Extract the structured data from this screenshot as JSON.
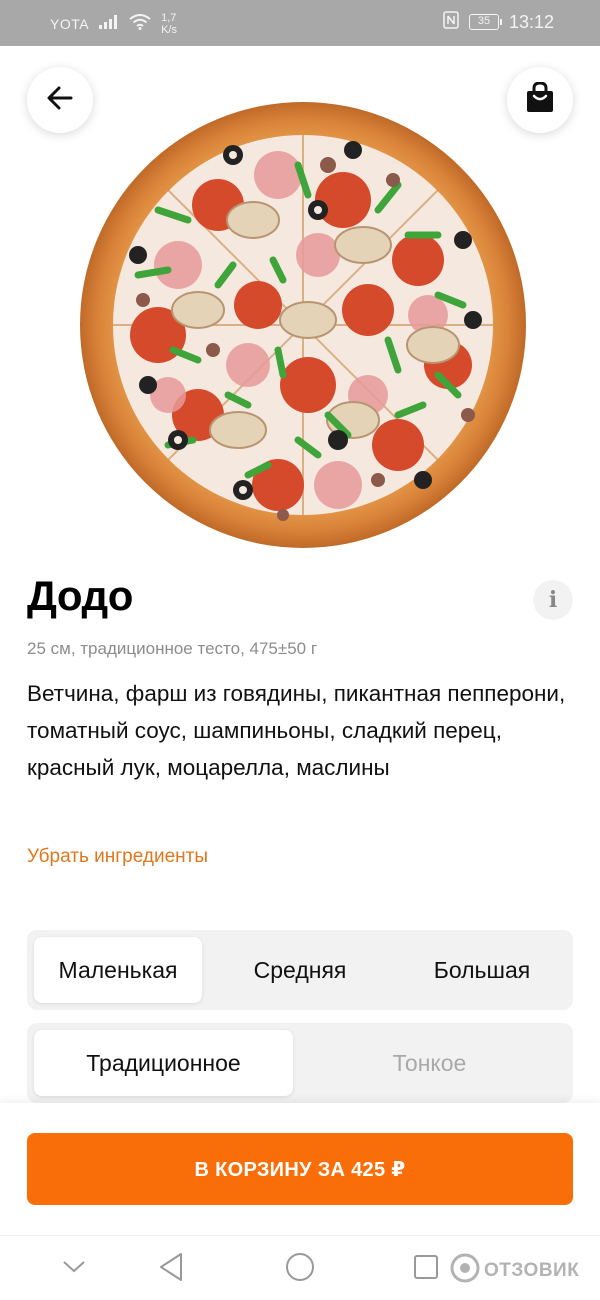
{
  "status_bar": {
    "carrier": "YOTA",
    "speed_value": "1,7",
    "speed_unit": "K/s",
    "battery": "35",
    "time": "13:12"
  },
  "top_bar": {
    "back_icon": "arrow-left-icon",
    "cart_icon": "shopping-bag-icon"
  },
  "product": {
    "image": "pizza-photo",
    "title": "Додо",
    "subtitle": "25 см, традиционное тесто, 475±50 г",
    "description": "Ветчина, фарш из говядины, пикантная пепперони, томатный соус, шампиньоны, сладкий перец, красный лук, моцарелла, маслины",
    "remove_ingredients_label": "Убрать ингредиенты",
    "info_icon": "info-icon"
  },
  "size_selector": {
    "options": [
      "Маленькая",
      "Средняя",
      "Большая"
    ],
    "selected": "Маленькая"
  },
  "dough_selector": {
    "options": [
      "Традиционное",
      "Тонкое"
    ],
    "selected": "Традиционное"
  },
  "cart_button": {
    "label": "В КОРЗИНУ ЗА 425 ₽"
  },
  "nav_bar": {
    "icons": [
      "nav-back-icon",
      "nav-home-icon",
      "nav-recents-icon",
      "nav-collapse-icon"
    ],
    "watermark": "ОТЗОВИК"
  },
  "colors": {
    "accent": "#fa6e0a",
    "link": "#e3761c",
    "status_bar": "#a8a8a8"
  }
}
